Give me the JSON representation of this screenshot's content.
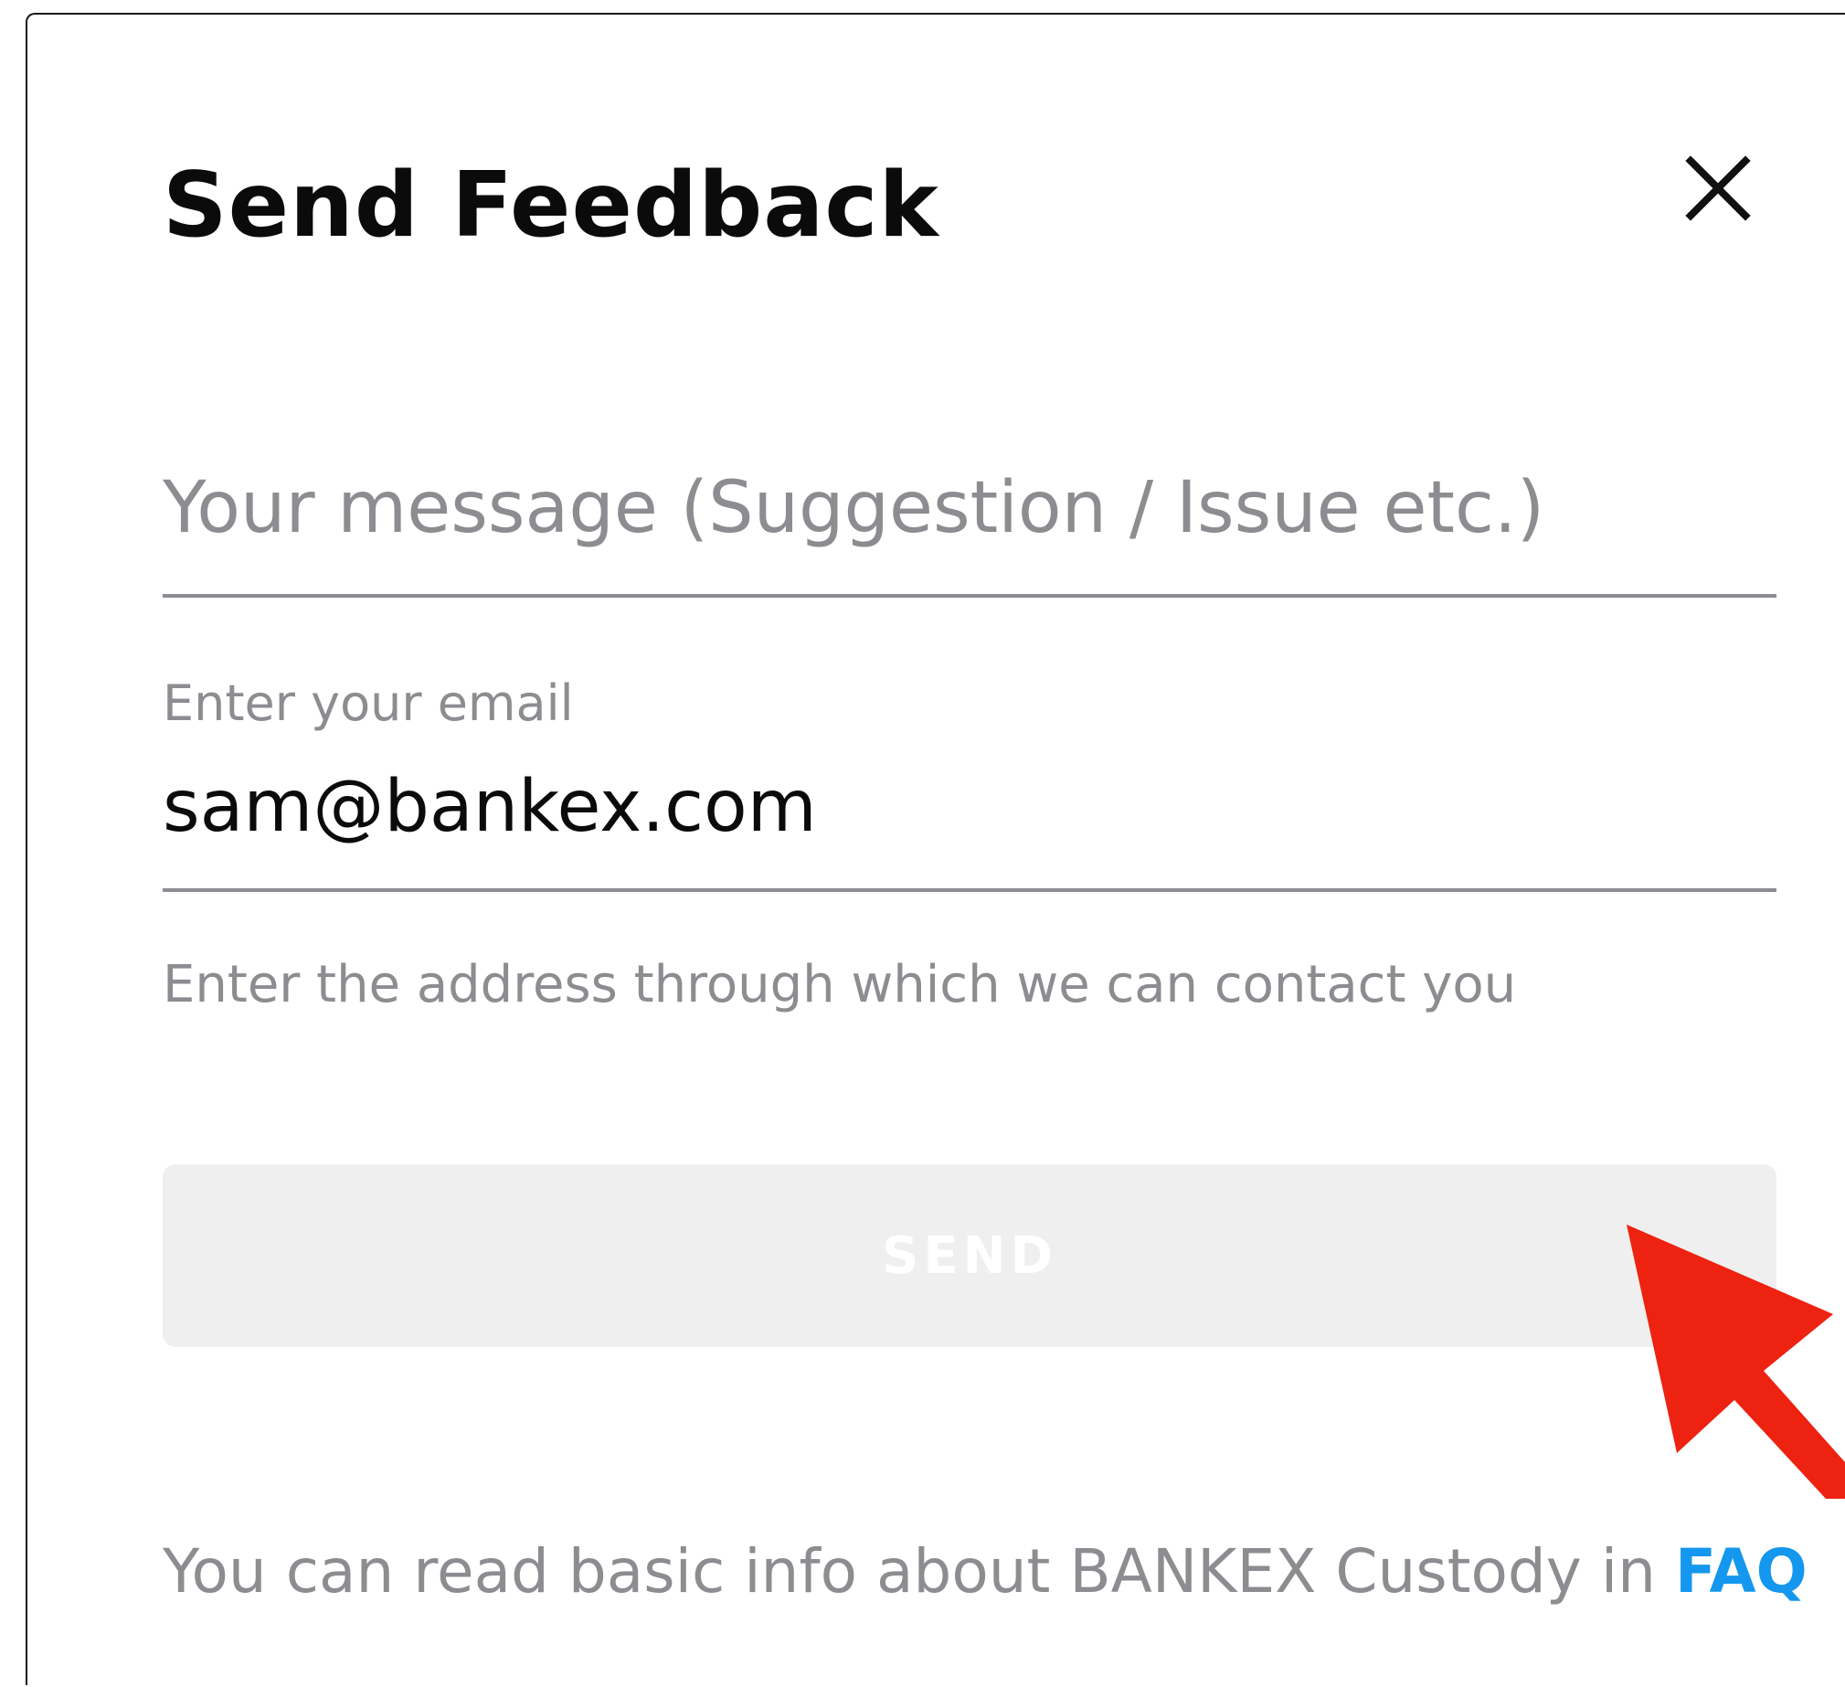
{
  "dialog": {
    "title": "Send Feedback",
    "close_icon": "close-icon"
  },
  "message": {
    "placeholder": "Your message (Suggestion / Issue etc.)",
    "value": ""
  },
  "email": {
    "label": "Enter your email",
    "value": "sam@bankex.com",
    "helper": "Enter the address through which we can contact you"
  },
  "send_button": {
    "label": "SEND",
    "state": "disabled"
  },
  "footer": {
    "text": "You can read basic info about BANKEX Custody in ",
    "link_label": "FAQ"
  },
  "annotation": {
    "arrow_icon": "red-arrow-icon",
    "color": "#ee2211"
  },
  "colors": {
    "accent": "#1497ee",
    "muted_text": "#8c8c91",
    "button_bg": "#efefef"
  }
}
